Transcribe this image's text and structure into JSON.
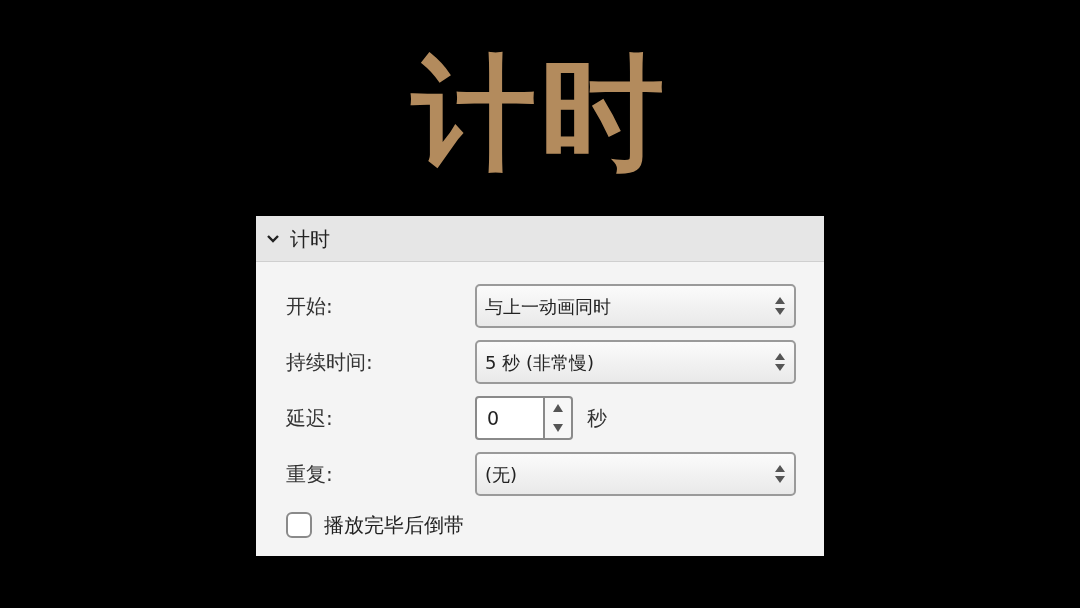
{
  "title": "计时",
  "panel": {
    "header": {
      "title": "计时",
      "expanded": true
    },
    "rows": [
      {
        "kind": "select",
        "label": "开始:",
        "value": "与上一动画同时"
      },
      {
        "kind": "select",
        "label": "持续时间:",
        "value": "5 秒 (非常慢)"
      },
      {
        "kind": "stepper",
        "label": "延迟:",
        "value": "0",
        "unit": "秒"
      },
      {
        "kind": "select",
        "label": "重复:",
        "value": "(无)"
      }
    ],
    "checkbox": {
      "label": "播放完毕后倒带",
      "checked": false
    }
  }
}
